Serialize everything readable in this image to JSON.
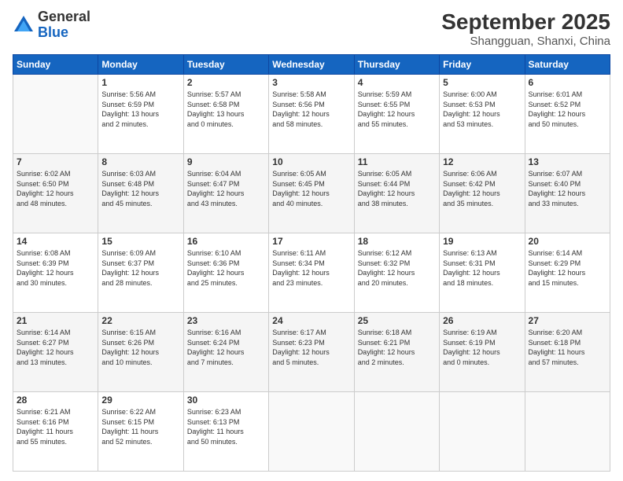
{
  "header": {
    "logo_general": "General",
    "logo_blue": "Blue",
    "month_title": "September 2025",
    "location": "Shangguan, Shanxi, China"
  },
  "weekdays": [
    "Sunday",
    "Monday",
    "Tuesday",
    "Wednesday",
    "Thursday",
    "Friday",
    "Saturday"
  ],
  "weeks": [
    [
      {
        "day": "",
        "info": ""
      },
      {
        "day": "1",
        "info": "Sunrise: 5:56 AM\nSunset: 6:59 PM\nDaylight: 13 hours\nand 2 minutes."
      },
      {
        "day": "2",
        "info": "Sunrise: 5:57 AM\nSunset: 6:58 PM\nDaylight: 13 hours\nand 0 minutes."
      },
      {
        "day": "3",
        "info": "Sunrise: 5:58 AM\nSunset: 6:56 PM\nDaylight: 12 hours\nand 58 minutes."
      },
      {
        "day": "4",
        "info": "Sunrise: 5:59 AM\nSunset: 6:55 PM\nDaylight: 12 hours\nand 55 minutes."
      },
      {
        "day": "5",
        "info": "Sunrise: 6:00 AM\nSunset: 6:53 PM\nDaylight: 12 hours\nand 53 minutes."
      },
      {
        "day": "6",
        "info": "Sunrise: 6:01 AM\nSunset: 6:52 PM\nDaylight: 12 hours\nand 50 minutes."
      }
    ],
    [
      {
        "day": "7",
        "info": "Sunrise: 6:02 AM\nSunset: 6:50 PM\nDaylight: 12 hours\nand 48 minutes."
      },
      {
        "day": "8",
        "info": "Sunrise: 6:03 AM\nSunset: 6:48 PM\nDaylight: 12 hours\nand 45 minutes."
      },
      {
        "day": "9",
        "info": "Sunrise: 6:04 AM\nSunset: 6:47 PM\nDaylight: 12 hours\nand 43 minutes."
      },
      {
        "day": "10",
        "info": "Sunrise: 6:05 AM\nSunset: 6:45 PM\nDaylight: 12 hours\nand 40 minutes."
      },
      {
        "day": "11",
        "info": "Sunrise: 6:05 AM\nSunset: 6:44 PM\nDaylight: 12 hours\nand 38 minutes."
      },
      {
        "day": "12",
        "info": "Sunrise: 6:06 AM\nSunset: 6:42 PM\nDaylight: 12 hours\nand 35 minutes."
      },
      {
        "day": "13",
        "info": "Sunrise: 6:07 AM\nSunset: 6:40 PM\nDaylight: 12 hours\nand 33 minutes."
      }
    ],
    [
      {
        "day": "14",
        "info": "Sunrise: 6:08 AM\nSunset: 6:39 PM\nDaylight: 12 hours\nand 30 minutes."
      },
      {
        "day": "15",
        "info": "Sunrise: 6:09 AM\nSunset: 6:37 PM\nDaylight: 12 hours\nand 28 minutes."
      },
      {
        "day": "16",
        "info": "Sunrise: 6:10 AM\nSunset: 6:36 PM\nDaylight: 12 hours\nand 25 minutes."
      },
      {
        "day": "17",
        "info": "Sunrise: 6:11 AM\nSunset: 6:34 PM\nDaylight: 12 hours\nand 23 minutes."
      },
      {
        "day": "18",
        "info": "Sunrise: 6:12 AM\nSunset: 6:32 PM\nDaylight: 12 hours\nand 20 minutes."
      },
      {
        "day": "19",
        "info": "Sunrise: 6:13 AM\nSunset: 6:31 PM\nDaylight: 12 hours\nand 18 minutes."
      },
      {
        "day": "20",
        "info": "Sunrise: 6:14 AM\nSunset: 6:29 PM\nDaylight: 12 hours\nand 15 minutes."
      }
    ],
    [
      {
        "day": "21",
        "info": "Sunrise: 6:14 AM\nSunset: 6:27 PM\nDaylight: 12 hours\nand 13 minutes."
      },
      {
        "day": "22",
        "info": "Sunrise: 6:15 AM\nSunset: 6:26 PM\nDaylight: 12 hours\nand 10 minutes."
      },
      {
        "day": "23",
        "info": "Sunrise: 6:16 AM\nSunset: 6:24 PM\nDaylight: 12 hours\nand 7 minutes."
      },
      {
        "day": "24",
        "info": "Sunrise: 6:17 AM\nSunset: 6:23 PM\nDaylight: 12 hours\nand 5 minutes."
      },
      {
        "day": "25",
        "info": "Sunrise: 6:18 AM\nSunset: 6:21 PM\nDaylight: 12 hours\nand 2 minutes."
      },
      {
        "day": "26",
        "info": "Sunrise: 6:19 AM\nSunset: 6:19 PM\nDaylight: 12 hours\nand 0 minutes."
      },
      {
        "day": "27",
        "info": "Sunrise: 6:20 AM\nSunset: 6:18 PM\nDaylight: 11 hours\nand 57 minutes."
      }
    ],
    [
      {
        "day": "28",
        "info": "Sunrise: 6:21 AM\nSunset: 6:16 PM\nDaylight: 11 hours\nand 55 minutes."
      },
      {
        "day": "29",
        "info": "Sunrise: 6:22 AM\nSunset: 6:15 PM\nDaylight: 11 hours\nand 52 minutes."
      },
      {
        "day": "30",
        "info": "Sunrise: 6:23 AM\nSunset: 6:13 PM\nDaylight: 11 hours\nand 50 minutes."
      },
      {
        "day": "",
        "info": ""
      },
      {
        "day": "",
        "info": ""
      },
      {
        "day": "",
        "info": ""
      },
      {
        "day": "",
        "info": ""
      }
    ]
  ]
}
